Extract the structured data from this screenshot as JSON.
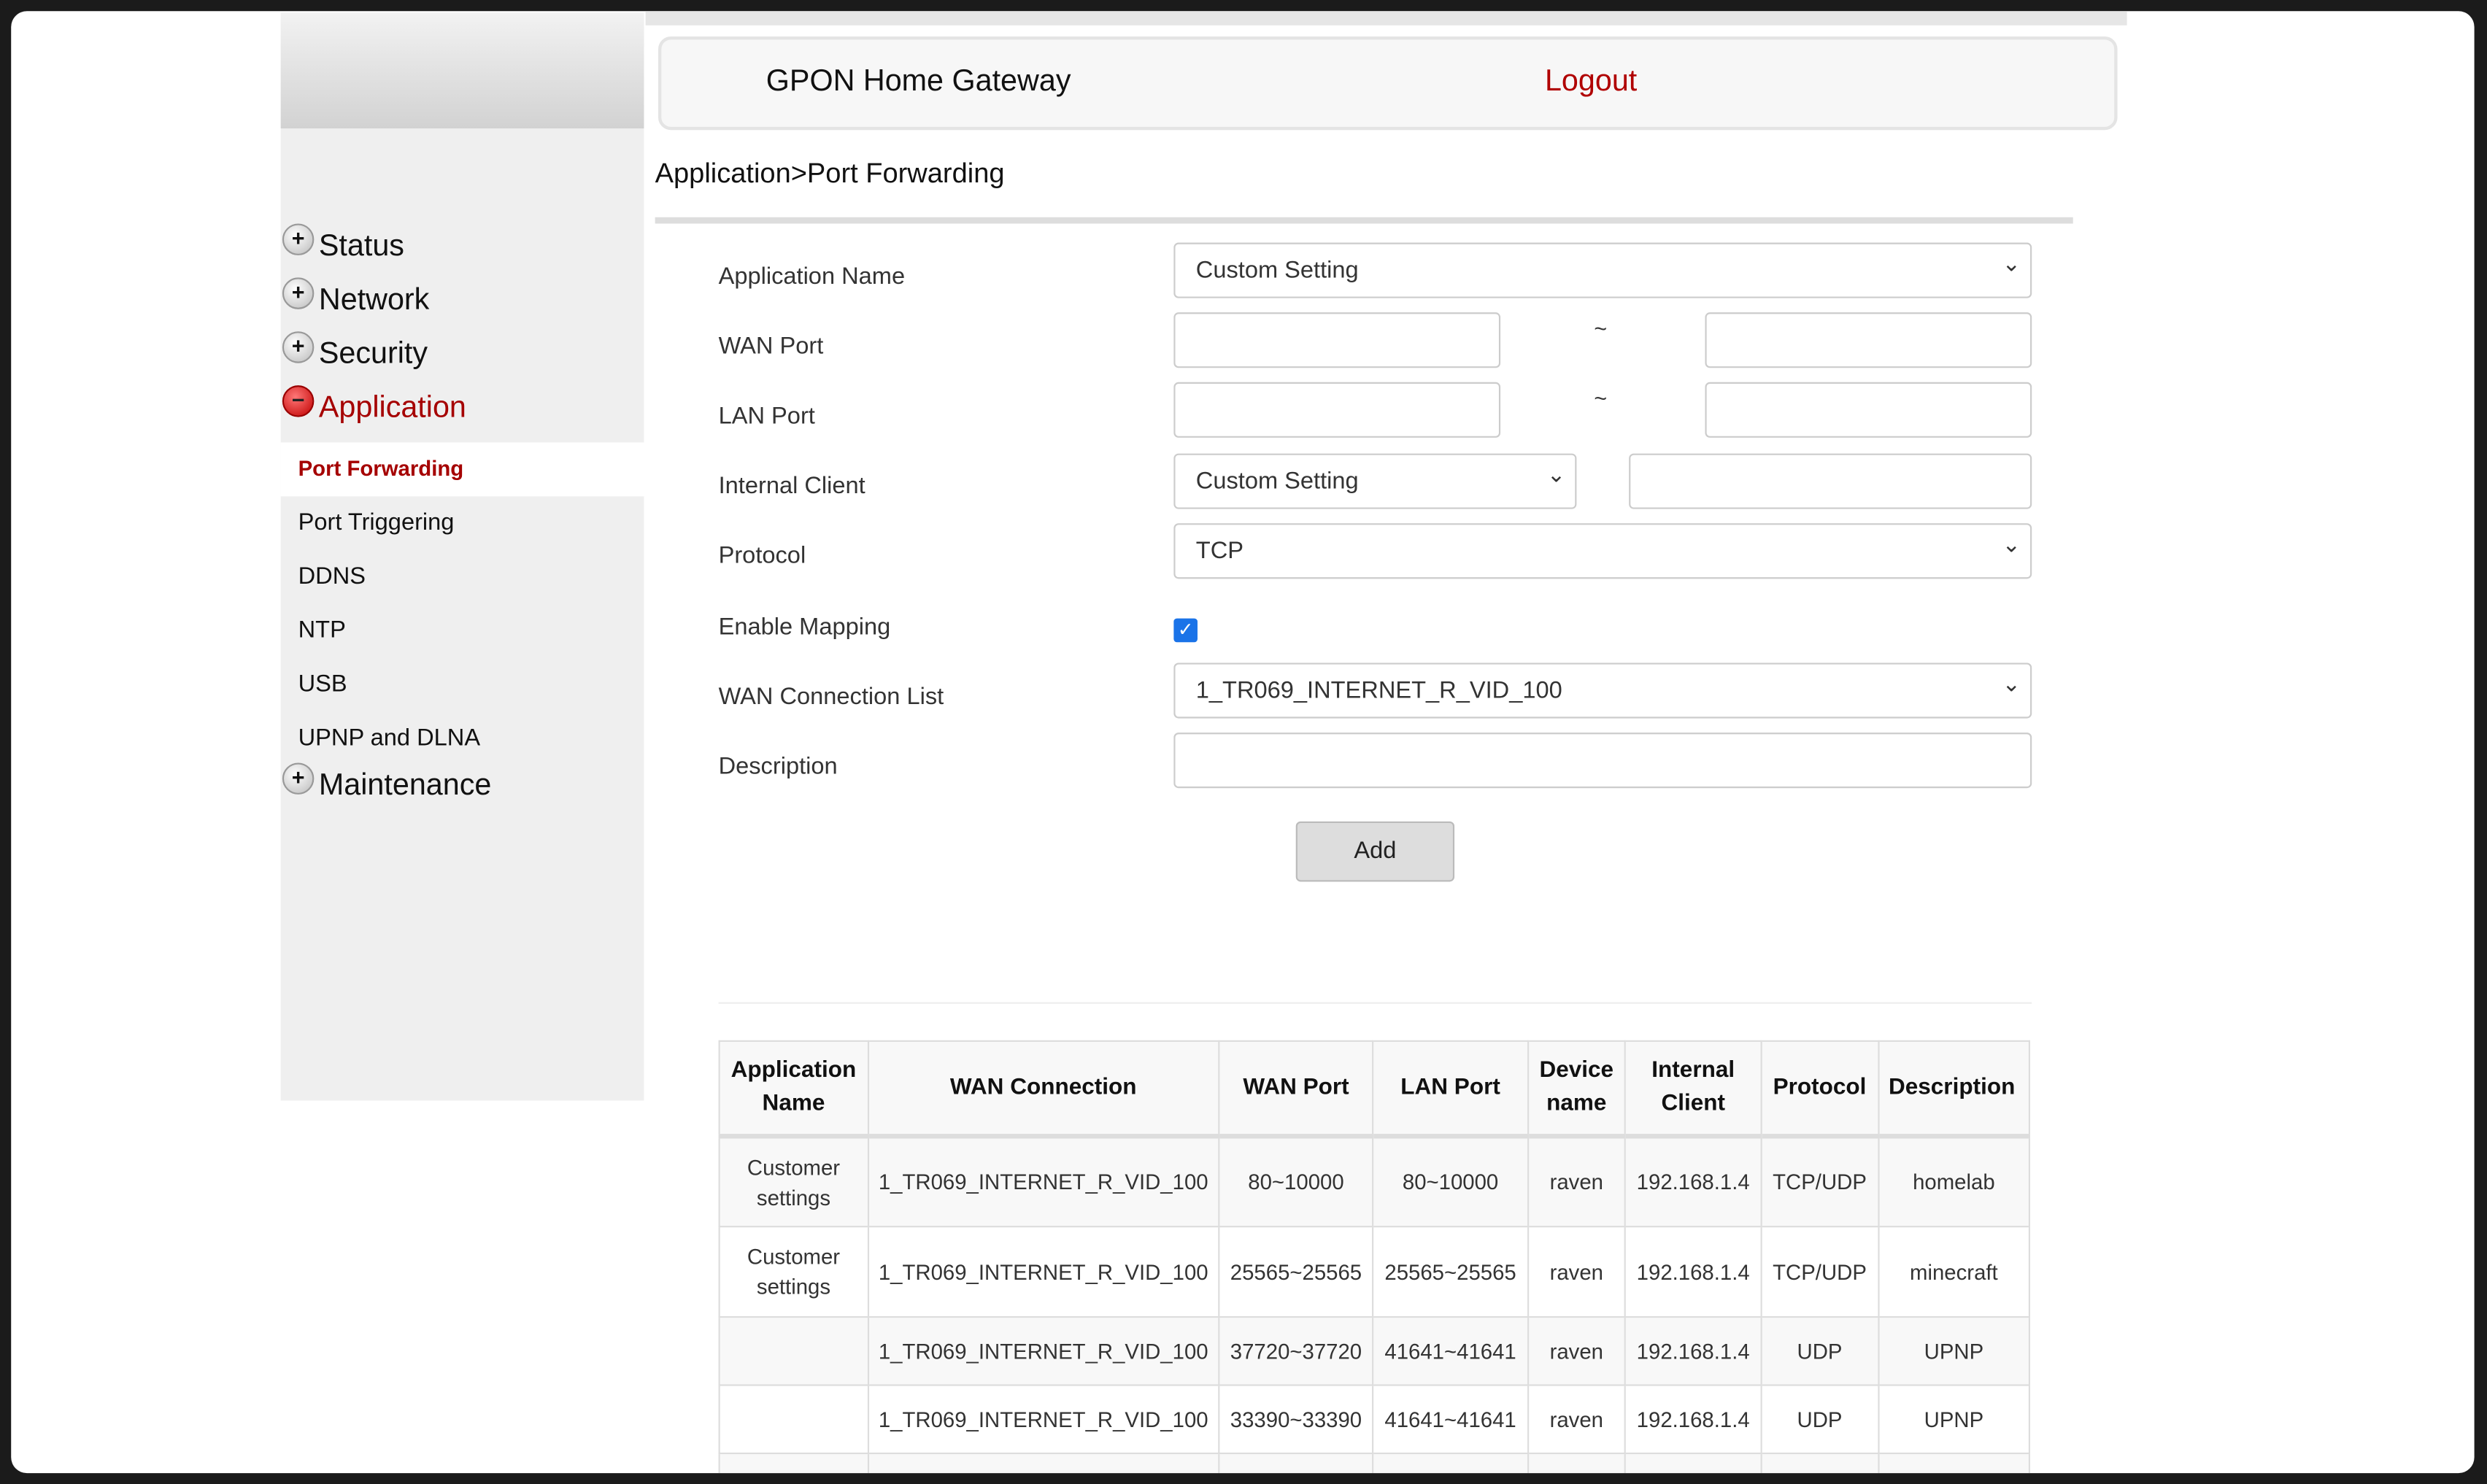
{
  "header": {
    "title": "GPON Home Gateway",
    "logout": "Logout"
  },
  "breadcrumb": "Application>Port Forwarding",
  "sidebar": {
    "menus": [
      {
        "label": "Status",
        "expanded": false
      },
      {
        "label": "Network",
        "expanded": false
      },
      {
        "label": "Security",
        "expanded": false
      },
      {
        "label": "Application",
        "expanded": true
      },
      {
        "label": "Maintenance",
        "expanded": false
      }
    ],
    "submenu": [
      "Port Forwarding",
      "Port Triggering",
      "DDNS",
      "NTP",
      "USB",
      "UPNP and DLNA"
    ]
  },
  "form": {
    "app_name_label": "Application Name",
    "app_name_value": "Custom Setting",
    "wan_port_label": "WAN Port",
    "lan_port_label": "LAN Port",
    "tilde": "~",
    "internal_client_label": "Internal Client",
    "internal_client_value": "Custom Setting",
    "protocol_label": "Protocol",
    "protocol_value": "TCP",
    "enable_mapping_label": "Enable Mapping",
    "enable_mapping_checked": true,
    "wan_conn_label": "WAN Connection List",
    "wan_conn_value": "1_TR069_INTERNET_R_VID_100",
    "description_label": "Description",
    "add_label": "Add"
  },
  "table": {
    "headers": [
      "Application Name",
      "WAN Connection",
      "WAN Port",
      "LAN Port",
      "Device name",
      "Internal Client",
      "Protocol",
      "Description"
    ],
    "rows": [
      [
        "Customer settings",
        "1_TR069_INTERNET_R_VID_100",
        "80~10000",
        "80~10000",
        "raven",
        "192.168.1.4",
        "TCP/UDP",
        "homelab"
      ],
      [
        "Customer settings",
        "1_TR069_INTERNET_R_VID_100",
        "25565~25565",
        "25565~25565",
        "raven",
        "192.168.1.4",
        "TCP/UDP",
        "minecraft"
      ],
      [
        "",
        "1_TR069_INTERNET_R_VID_100",
        "37720~37720",
        "41641~41641",
        "raven",
        "192.168.1.4",
        "UDP",
        "UPNP"
      ],
      [
        "",
        "1_TR069_INTERNET_R_VID_100",
        "33390~33390",
        "41641~41641",
        "raven",
        "192.168.1.4",
        "UDP",
        "UPNP"
      ],
      [
        "",
        "",
        "",
        "",
        "",
        "",
        "",
        ""
      ]
    ]
  }
}
